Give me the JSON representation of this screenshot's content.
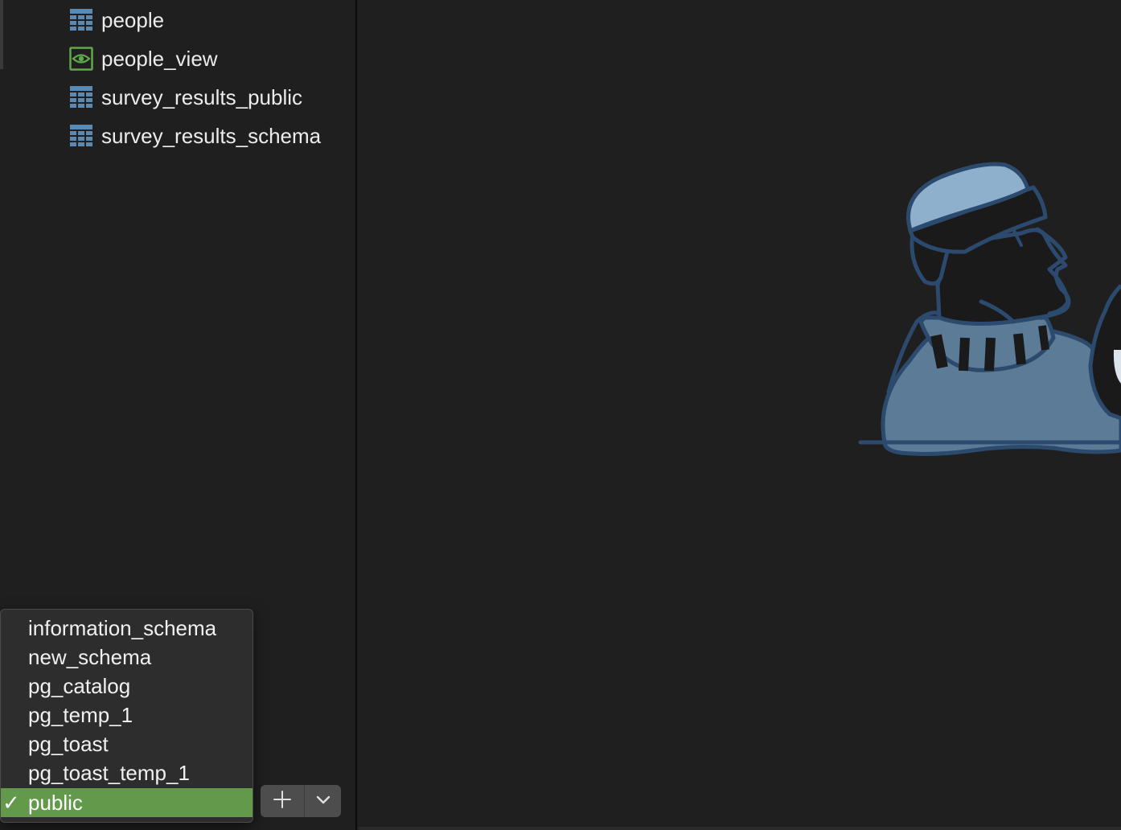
{
  "sidebar": {
    "items": [
      {
        "label": "people",
        "icon": "table-icon"
      },
      {
        "label": "people_view",
        "icon": "view-eye-icon"
      },
      {
        "label": "survey_results_public",
        "icon": "table-icon"
      },
      {
        "label": "survey_results_schema",
        "icon": "table-icon"
      }
    ]
  },
  "schema_menu": {
    "options": [
      "information_schema",
      "new_schema",
      "pg_catalog",
      "pg_temp_1",
      "pg_toast",
      "pg_toast_temp_1",
      "public"
    ],
    "selected": "public",
    "check_mark": "✓"
  },
  "toolbar": {
    "add_icon": "plus-icon",
    "menu_icon": "chevron-down-icon"
  },
  "colors": {
    "background": "#1f1f1f",
    "selection": "#62994a",
    "table_icon": "#5a8ab4",
    "view_icon": "#5fa84a",
    "illustration_fill": "#5b7b97",
    "illustration_stroke": "#2c4a6e"
  }
}
